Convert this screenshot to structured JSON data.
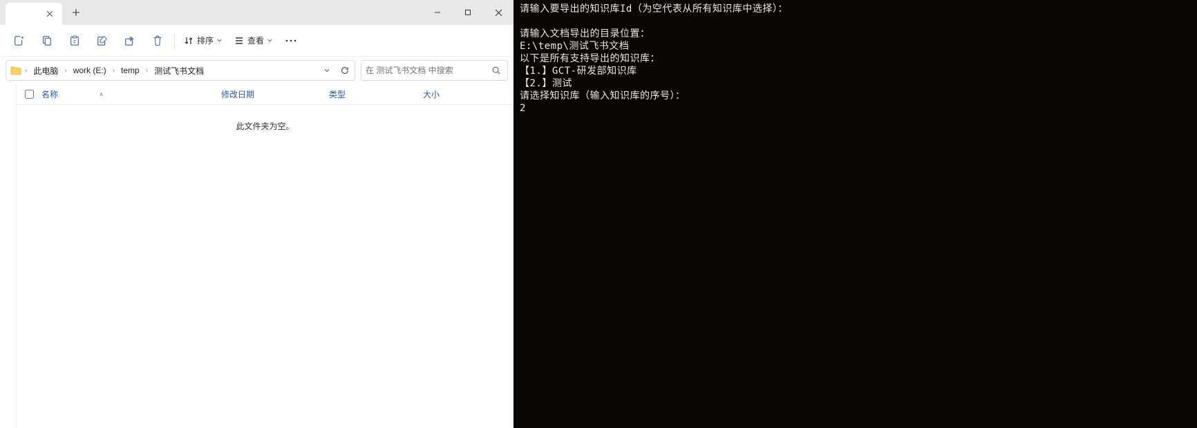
{
  "explorer": {
    "window": {
      "minimize": "–",
      "maximize": "☐",
      "close": "✕"
    },
    "toolbar": {
      "sort_label": "排序",
      "view_label": "查看"
    },
    "breadcrumb": {
      "items": [
        "此电脑",
        "work (E:)",
        "temp",
        "测试飞书文档"
      ]
    },
    "search": {
      "placeholder": "在 测试飞书文档 中搜索"
    },
    "columns": {
      "name": "名称",
      "date": "修改日期",
      "type": "类型",
      "size": "大小"
    },
    "empty": "此文件夹为空。"
  },
  "terminal": {
    "lines": [
      "请输入要导出的知识库Id（为空代表从所有知识库中选择）：",
      "",
      "请输入文档导出的目录位置：",
      "E:\\temp\\测试飞书文档",
      "以下是所有支持导出的知识库：",
      "【1.】GCT-研发部知识库",
      "【2.】测试",
      "请选择知识库（输入知识库的序号）：",
      "2"
    ]
  }
}
